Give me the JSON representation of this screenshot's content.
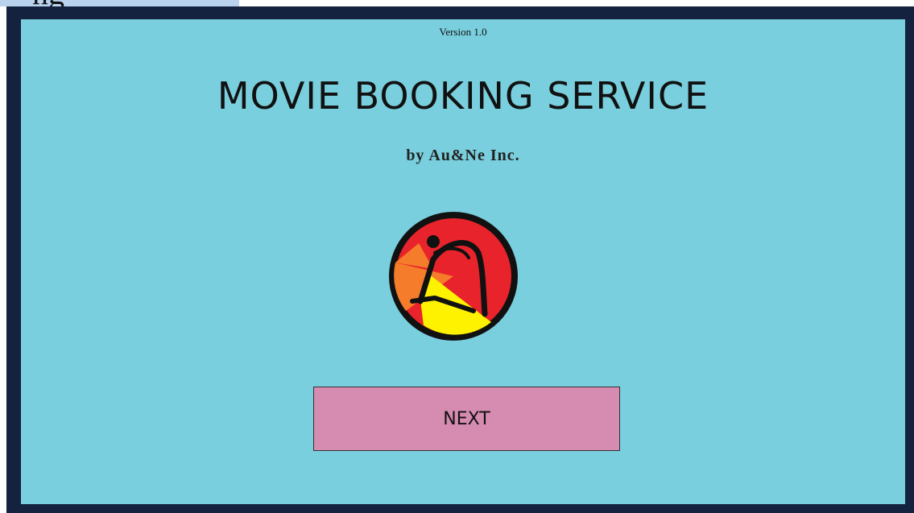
{
  "window": {
    "tab_fragment": "ng"
  },
  "header": {
    "version": "Version 1.0",
    "title": "MOVIE BOOKING SERVICE",
    "subtitle": "by Au&Ne Inc."
  },
  "logo": {
    "icon": "company-logo-icon",
    "colors": {
      "ring": "#111111",
      "red": "#e8232b",
      "orange": "#f47c2a",
      "yellow": "#fff200"
    }
  },
  "actions": {
    "next_label": "NEXT"
  },
  "colors": {
    "frame": "#14223f",
    "panel": "#79cfdd",
    "button": "#d68bb1",
    "tab": "#b9d3ee"
  }
}
